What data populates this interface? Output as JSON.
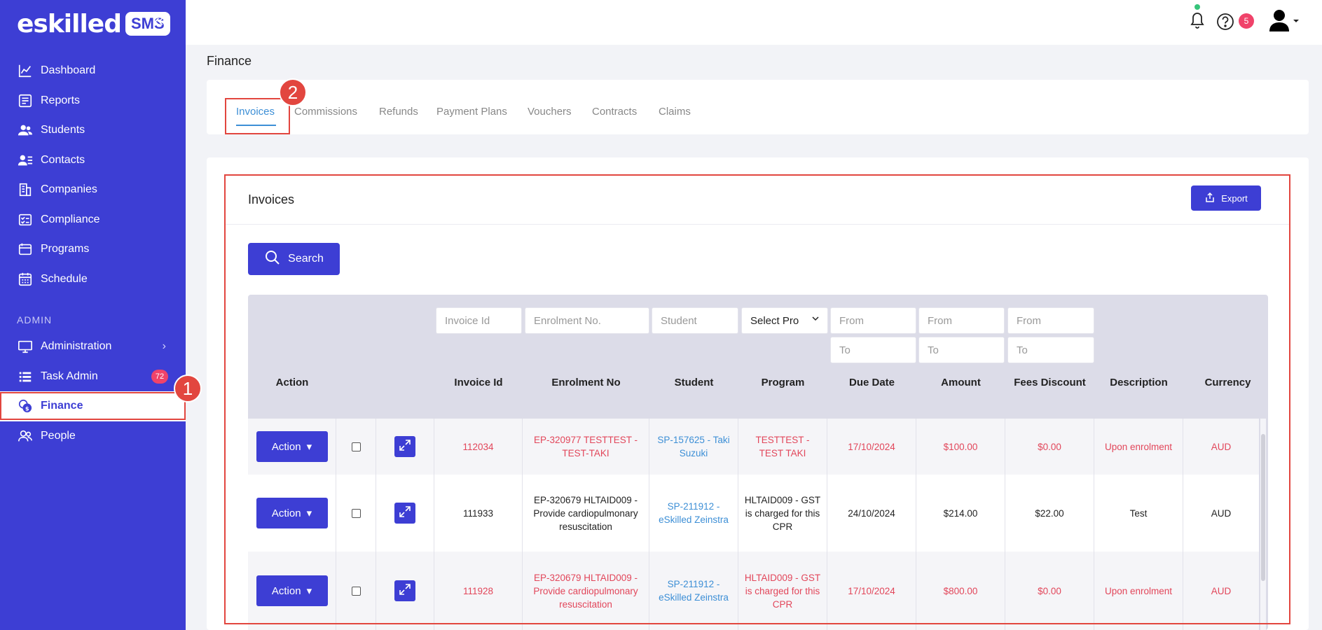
{
  "brand": {
    "logo_text": "eskilled",
    "logo_badge": "SMS",
    "collapse_icon": "double-chevron-left-icon"
  },
  "nav": {
    "items": [
      {
        "label": "Dashboard",
        "icon": "chart-line-icon"
      },
      {
        "label": "Reports",
        "icon": "report-icon"
      },
      {
        "label": "Students",
        "icon": "students-icon"
      },
      {
        "label": "Contacts",
        "icon": "contacts-icon"
      },
      {
        "label": "Companies",
        "icon": "building-icon"
      },
      {
        "label": "Compliance",
        "icon": "checklist-icon"
      },
      {
        "label": "Programs",
        "icon": "programs-icon"
      },
      {
        "label": "Schedule",
        "icon": "calendar-icon"
      }
    ],
    "section_label": "ADMIN",
    "admin_items": [
      {
        "label": "Administration",
        "icon": "monitor-icon"
      },
      {
        "label": "Task Admin",
        "icon": "task-list-icon",
        "badge": "72"
      },
      {
        "label": "Finance",
        "icon": "finance-coins-icon"
      },
      {
        "label": "People",
        "icon": "people-icon"
      }
    ]
  },
  "topbar": {
    "help_badge": "5"
  },
  "markers": {
    "one": "1",
    "two": "2"
  },
  "page": {
    "title": "Finance"
  },
  "tabs": [
    "Invoices",
    "Commissions",
    "Refunds",
    "Payment Plans",
    "Vouchers",
    "Contracts",
    "Claims"
  ],
  "invoices": {
    "title": "Invoices",
    "export_label": "Export",
    "search_label": "Search",
    "filters": {
      "invoice_id": "Invoice Id",
      "enrolment_no": "Enrolment No.",
      "student": "Student",
      "program": "Select Pro",
      "from": "From",
      "to": "To"
    },
    "columns": [
      "Action",
      "Invoice Id",
      "Enrolment No",
      "Student",
      "Program",
      "Due Date",
      "Amount",
      "Fees Discount",
      "Description",
      "Currency"
    ],
    "action_label": "Action",
    "rows": [
      {
        "invoice_id": "112034",
        "enrolment": "EP-320977 TESTTEST - TEST-TAKI",
        "student": "SP-157625 - Taki Suzuki",
        "program": "TESTTEST - TEST TAKI",
        "due_date": "17/10/2024",
        "amount": "$100.00",
        "discount": "$0.00",
        "description": "Upon enrolment",
        "currency": "AUD"
      },
      {
        "invoice_id": "111933",
        "enrolment": "EP-320679 HLTAID009 - Provide cardiopulmonary resuscitation",
        "student": "SP-211912 - eSkilled Zeinstra",
        "program": "HLTAID009 - GST is charged for this CPR",
        "due_date": "24/10/2024",
        "amount": "$214.00",
        "discount": "$22.00",
        "description": "Test",
        "currency": "AUD"
      },
      {
        "invoice_id": "111928",
        "enrolment": "EP-320679 HLTAID009 - Provide cardiopulmonary resuscitation",
        "student": "SP-211912 - eSkilled Zeinstra",
        "program": "HLTAID009 - GST is charged for this CPR",
        "due_date": "17/10/2024",
        "amount": "$800.00",
        "discount": "$0.00",
        "description": "Upon enrolment",
        "currency": "AUD"
      }
    ]
  }
}
